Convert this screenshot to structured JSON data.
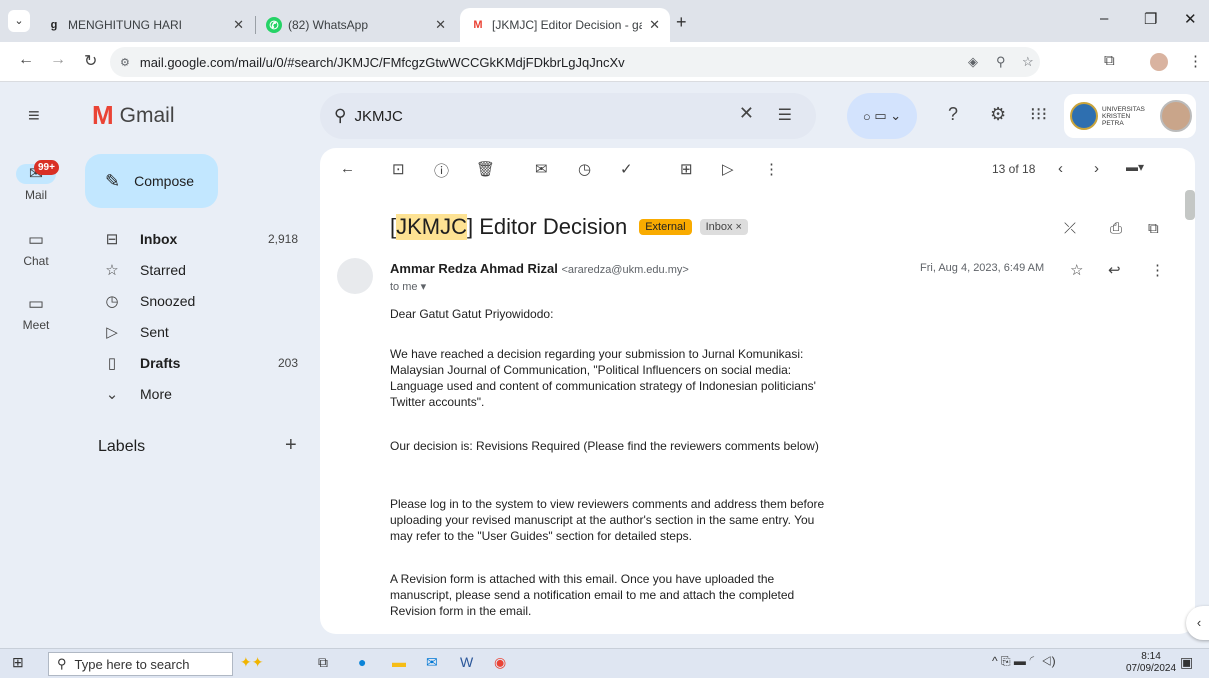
{
  "tabs": [
    {
      "title": "MENGHITUNG HARI",
      "favicon": "g-icon",
      "active": false
    },
    {
      "title": "(82) WhatsApp",
      "favicon": "whatsapp-icon",
      "active": false
    },
    {
      "title": "[JKMJC] Editor Decision - gatpri",
      "favicon": "gmail-icon",
      "active": true
    }
  ],
  "address_bar": {
    "url": "mail.google.com/mail/u/0/#search/JKMJC/FMfcgzGtwWCCGkKMdjFDkbrLgJqJncXv"
  },
  "gmail": {
    "logo_text": "Gmail"
  },
  "search": {
    "query": "JKMJC"
  },
  "org_badge": {
    "line1": "UNIVERSITAS",
    "line2": "KRISTEN",
    "line3": "PETRA"
  },
  "rail": {
    "mail_badge": "99+",
    "items": [
      {
        "label": "Mail"
      },
      {
        "label": "Chat"
      },
      {
        "label": "Meet"
      }
    ]
  },
  "compose_label": "Compose",
  "nav": [
    {
      "label": "Inbox",
      "count": "2,918",
      "bold": true
    },
    {
      "label": "Starred",
      "count": ""
    },
    {
      "label": "Snoozed",
      "count": ""
    },
    {
      "label": "Sent",
      "count": ""
    },
    {
      "label": "Drafts",
      "count": "203",
      "bold": true
    },
    {
      "label": "More",
      "count": ""
    }
  ],
  "labels_heading": "Labels",
  "toolbar": {
    "pager": "13 of 18"
  },
  "email": {
    "subject_prefix": "[",
    "subject_hl": "JKMJC",
    "subject_rest": "] Editor Decision",
    "tag_external": "External",
    "tag_inbox": "Inbox ×",
    "sender_name": "Ammar Redza Ahmad Rizal",
    "sender_email": "<araredza@ukm.edu.my>",
    "to": "to me ▾",
    "date": "Fri, Aug 4, 2023, 6:49 AM",
    "paragraphs": [
      "Dear Gatut Gatut Priyowidodo:",
      "We have reached a decision regarding your submission to Jurnal Komunikasi: Malaysian Journal of Communication, \"Political Influencers on social media: Language used and content of communication strategy of Indonesian politicians' Twitter accounts\".",
      "Our decision is: Revisions Required (Please find the reviewers comments below)",
      "Please log in to the system to view reviewers comments and address them before uploading your revised manuscript at the author's section in the same entry. You may refer to the \"User Guides\" section for detailed steps.",
      "A Revision form is attached with this email. Once you have uploaded the manuscript, please send a notification email to me and attach the completed Revision form in the email."
    ]
  },
  "taskbar": {
    "search_placeholder": "Type here to search",
    "time": "8:14",
    "date": "07/09/2024"
  }
}
